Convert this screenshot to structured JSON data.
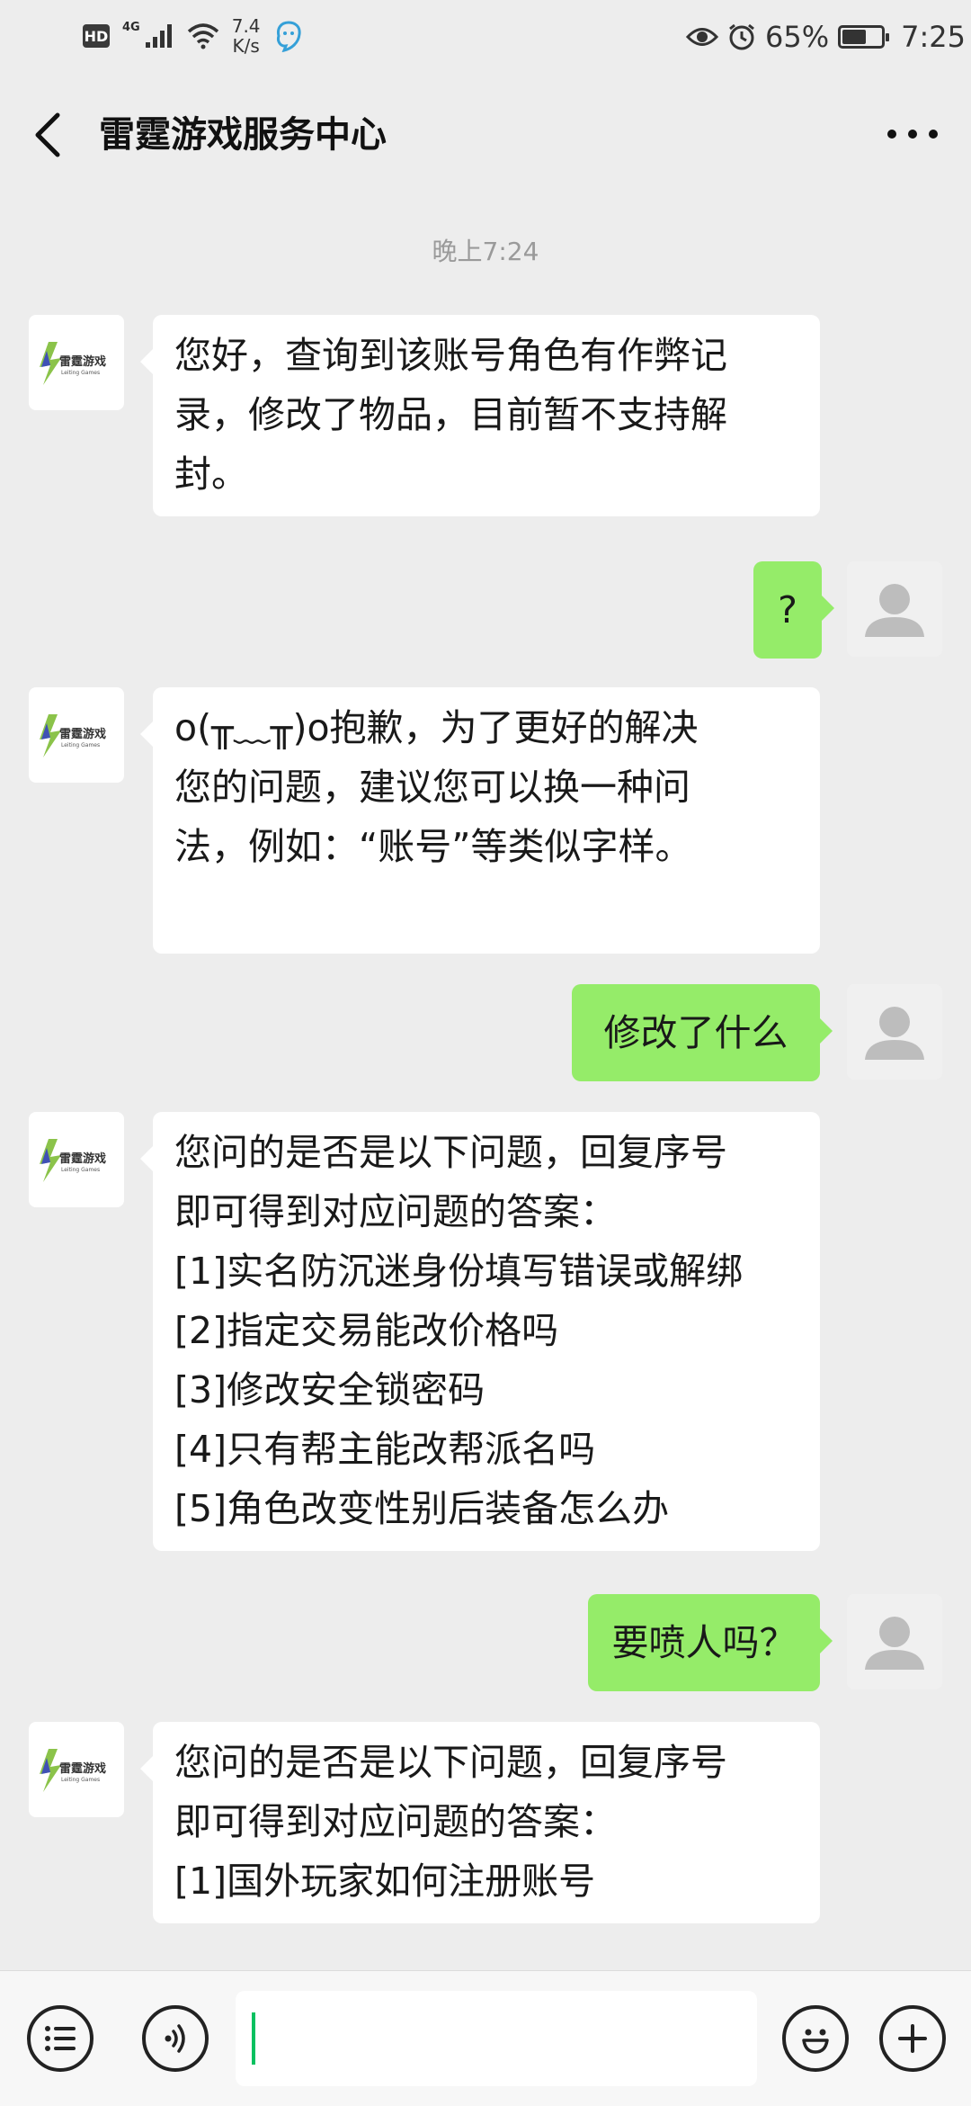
{
  "status_bar": {
    "hd": "HD",
    "network": "4G",
    "speed_value": "7.4",
    "speed_unit": "K/s",
    "battery": "65%",
    "battery_level": 0.65,
    "time": "7:25"
  },
  "header": {
    "title": "雷霆游戏服务中心"
  },
  "time_divider": "晚上7:24",
  "messages": {
    "m1": {
      "lines": [
        "您好，查询到该账号角色有作弊记",
        "录，修改了物品，目前暂不支持解",
        "封。"
      ]
    },
    "m2": {
      "text": "?"
    },
    "m3": {
      "lines": [
        "o(╥﹏╥)o抱歉，为了更好的解决",
        "您的问题，建议您可以换一种问",
        "法，例如：“账号”等类似字样。"
      ]
    },
    "m4": {
      "text": "修改了什么"
    },
    "m5": {
      "lines": [
        "您问的是否是以下问题，回复序号",
        "即可得到对应问题的答案：",
        "[1]实名防沉迷身份填写错误或解绑",
        "[2]指定交易能改价格吗",
        "[3]修改安全锁密码",
        "[4]只有帮主能改帮派名吗",
        "[5]角色改变性别后装备怎么办"
      ]
    },
    "m6": {
      "text": "要喷人吗？"
    },
    "m7": {
      "lines": [
        "您问的是否是以下问题，回复序号",
        "即可得到对应问题的答案：",
        "[1]国外玩家如何注册账号"
      ]
    }
  },
  "avatar_brand": {
    "name": "雷霆游戏",
    "sub": "Leiting Games"
  },
  "bottom_bar": {
    "input_value": ""
  },
  "colors": {
    "background": "#ededed",
    "out_bubble": "#95ec69",
    "in_bubble": "#ffffff",
    "cursor": "#07c160"
  },
  "icons": [
    "back-arrow-icon",
    "more-icon",
    "menu-list-icon",
    "voice-icon",
    "emoji-icon",
    "plus-icon",
    "eye-icon",
    "alarm-icon",
    "wifi-icon",
    "signal-icon"
  ]
}
